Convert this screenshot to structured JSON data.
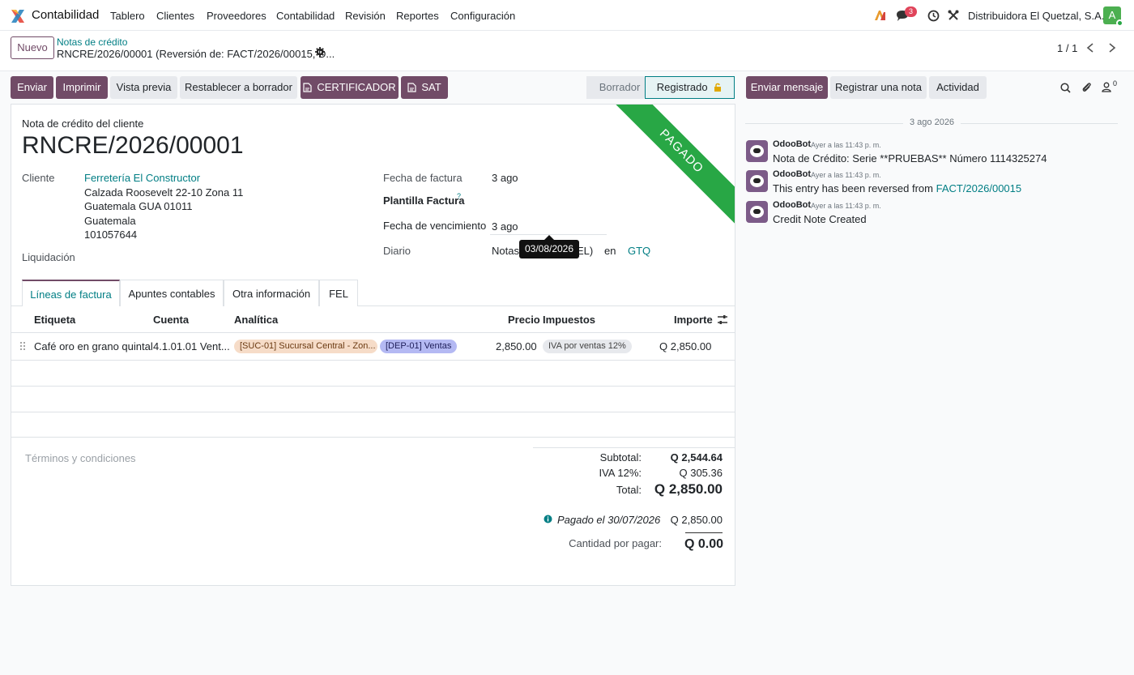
{
  "navbar": {
    "app_name": "Contabilidad",
    "menus": [
      "Tablero",
      "Clientes",
      "Proveedores",
      "Contabilidad",
      "Revisión",
      "Reportes",
      "Configuración"
    ],
    "messages_count": "3",
    "company": "Distribuidora El Quetzal, S.A.",
    "avatar_letter": "A"
  },
  "control_panel": {
    "new_label": "Nuevo",
    "breadcrumb_parent": "Notas de crédito",
    "breadcrumb_current": "RNCRE/2026/00001 (Reversión de: FACT/2026/00015, D...",
    "pager": "1 / 1"
  },
  "actions": {
    "send": "Enviar",
    "print": "Imprimir",
    "preview": "Vista previa",
    "reset": "Restablecer a borrador",
    "certifier": "CERTIFICADOR",
    "sat": "SAT"
  },
  "status": {
    "draft": "Borrador",
    "posted": "Registrado"
  },
  "form": {
    "ribbon": "PAGADO",
    "doc_type": "Nota de crédito del cliente",
    "name": "RNCRE/2026/00001",
    "customer_label": "Cliente",
    "customer_name": "Ferretería El Constructor",
    "address_1": "Calzada Roosevelt 22-10 Zona 11",
    "address_2": "Guatemala GUA 01011",
    "address_3": "Guatemala",
    "tax_id": "101057644",
    "settlement_label": "Liquidación",
    "invoice_date_label": "Fecha de factura",
    "invoice_date": "3 ago",
    "template_label": "Plantilla Factura",
    "template_help": "?",
    "due_date_label": "Fecha de vencimiento",
    "due_date": "3 ago",
    "journal_label": "Diario",
    "journal_value_start": "Notas",
    "journal_value_end": "EL)",
    "journal_in": "en",
    "currency": "GTQ",
    "tooltip": "03/08/2026"
  },
  "tabs": [
    "Líneas de factura",
    "Apuntes contables",
    "Otra información",
    "FEL"
  ],
  "lines": {
    "headers": {
      "label": "Etiqueta",
      "account": "Cuenta",
      "analytic": "Analítica",
      "price": "Precio",
      "taxes": "Impuestos",
      "amount": "Importe"
    },
    "rows": [
      {
        "label": "Café oro en grano quintal",
        "account": "4.1.01.01 Vent...",
        "analytic_1": "[SUC-01] Sucursal Central - Zon...",
        "analytic_2": "[DEP-01] Ventas",
        "price": "2,850.00",
        "tax": "IVA por ventas 12%",
        "amount": "Q 2,850.00"
      }
    ]
  },
  "terms_placeholder": "Términos y condiciones",
  "totals": {
    "subtotal_label": "Subtotal:",
    "subtotal": "Q 2,544.64",
    "iva_label": "IVA 12%:",
    "iva": "Q 305.36",
    "total_label": "Total:",
    "total": "Q 2,850.00",
    "paid_label": "Pagado el 30/07/2026",
    "paid": "Q 2,850.00",
    "due_label": "Cantidad por pagar:",
    "due": "Q 0.00"
  },
  "chatter": {
    "send_message": "Enviar mensaje",
    "log_note": "Registrar una nota",
    "activity": "Actividad",
    "followers_count": "0",
    "date_separator": "3 ago 2026",
    "messages": [
      {
        "author": "OdooBot",
        "time": "Ayer a las 11:43 p. m.",
        "body": "Nota de Crédito: Serie **PRUEBAS** Número 1114325274"
      },
      {
        "author": "OdooBot",
        "time": "Ayer a las 11:43 p. m.",
        "body": "This entry has been reversed from ",
        "link": "FACT/2026/00015"
      },
      {
        "author": "OdooBot",
        "time": "Ayer a las 11:43 p. m.",
        "body": "Credit Note Created"
      }
    ]
  },
  "colors": {
    "primary": "#714b67",
    "link": "#017e84",
    "paid_ribbon": "#28a745",
    "badge": "#e0445a"
  }
}
